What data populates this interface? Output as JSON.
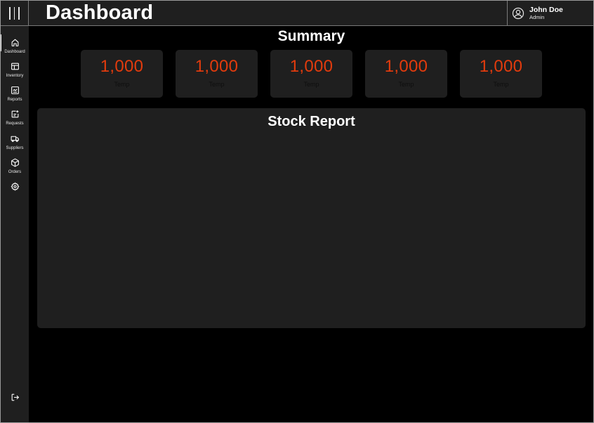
{
  "header": {
    "title": "Dashboard",
    "user": {
      "name": "John Doe",
      "role": "Admin"
    }
  },
  "sidebar": {
    "items": [
      {
        "label": "Dashboard",
        "icon": "home-icon",
        "active": true
      },
      {
        "label": "Inventory",
        "icon": "table-icon"
      },
      {
        "label": "Reports",
        "icon": "report-icon"
      },
      {
        "label": "Requests",
        "icon": "request-icon"
      },
      {
        "label": "Suppliers",
        "icon": "truck-icon"
      },
      {
        "label": "Orders",
        "icon": "box-icon"
      },
      {
        "label": "",
        "icon": "gear-icon"
      }
    ],
    "logout_icon": "logout-icon"
  },
  "summary": {
    "title": "Summary",
    "cards": [
      {
        "value": "1,000",
        "label": "Temp"
      },
      {
        "value": "1,000",
        "label": "Temp"
      },
      {
        "value": "1,000",
        "label": "Temp"
      },
      {
        "value": "1,000",
        "label": "Temp"
      },
      {
        "value": "1,000",
        "label": "Temp"
      }
    ]
  },
  "stock_report": {
    "title": "Stock Report"
  },
  "colors": {
    "background": "#000000",
    "panel": "#1f1f1f",
    "accent": "#e23b0d",
    "text": "#ffffff"
  }
}
